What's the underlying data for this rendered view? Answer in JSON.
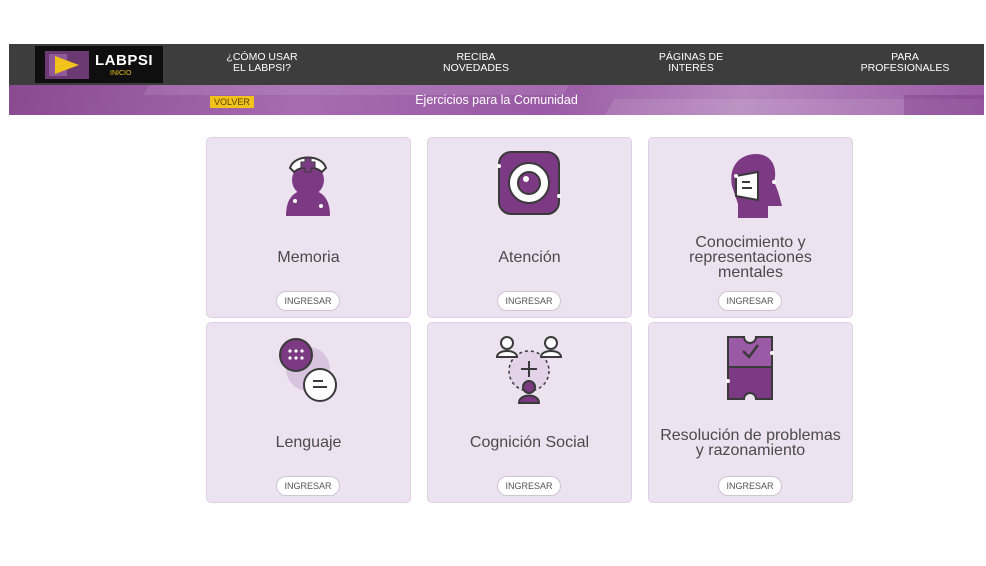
{
  "header": {
    "logo_text": "LABPSI",
    "logo_sub": "INICIO",
    "nav": [
      {
        "line1": "¿CÓMO USAR",
        "line2": "EL LABPSI?"
      },
      {
        "line1": "RECIBA",
        "line2": "NOVEDADES"
      },
      {
        "line1": "PÁGINAS DE",
        "line2": "INTERÉS"
      },
      {
        "line1": "PARA",
        "line2": "PROFESIONALES"
      }
    ]
  },
  "subbar": {
    "back_label": "VOLVER",
    "title": "Ejercicios para la Comunidad"
  },
  "cards": [
    {
      "title": "Memoria",
      "button": "INGRESAR",
      "icon": "nurse-person-icon"
    },
    {
      "title": "Atención",
      "button": "INGRESAR",
      "icon": "eye-focus-icon"
    },
    {
      "title_lines": [
        "Conocimiento y",
        "representaciones",
        "mentales"
      ],
      "button": "INGRESAR",
      "icon": "head-profile-icon"
    },
    {
      "title": "Lenguaje",
      "button": "INGRESAR",
      "icon": "speech-bubbles-icon"
    },
    {
      "title": "Cognición Social",
      "button": "INGRESAR",
      "icon": "people-network-icon"
    },
    {
      "title_lines": [
        "Resolución de problemas",
        "y razonamiento"
      ],
      "button": "INGRESAR",
      "icon": "puzzle-icon"
    }
  ],
  "colors": {
    "topbar": "#3d3d3d",
    "subbar": "#9a5aa5",
    "card_bg": "#ede2f0",
    "icon_purple": "#7b3a83",
    "accent_yellow": "#f2c31b"
  }
}
